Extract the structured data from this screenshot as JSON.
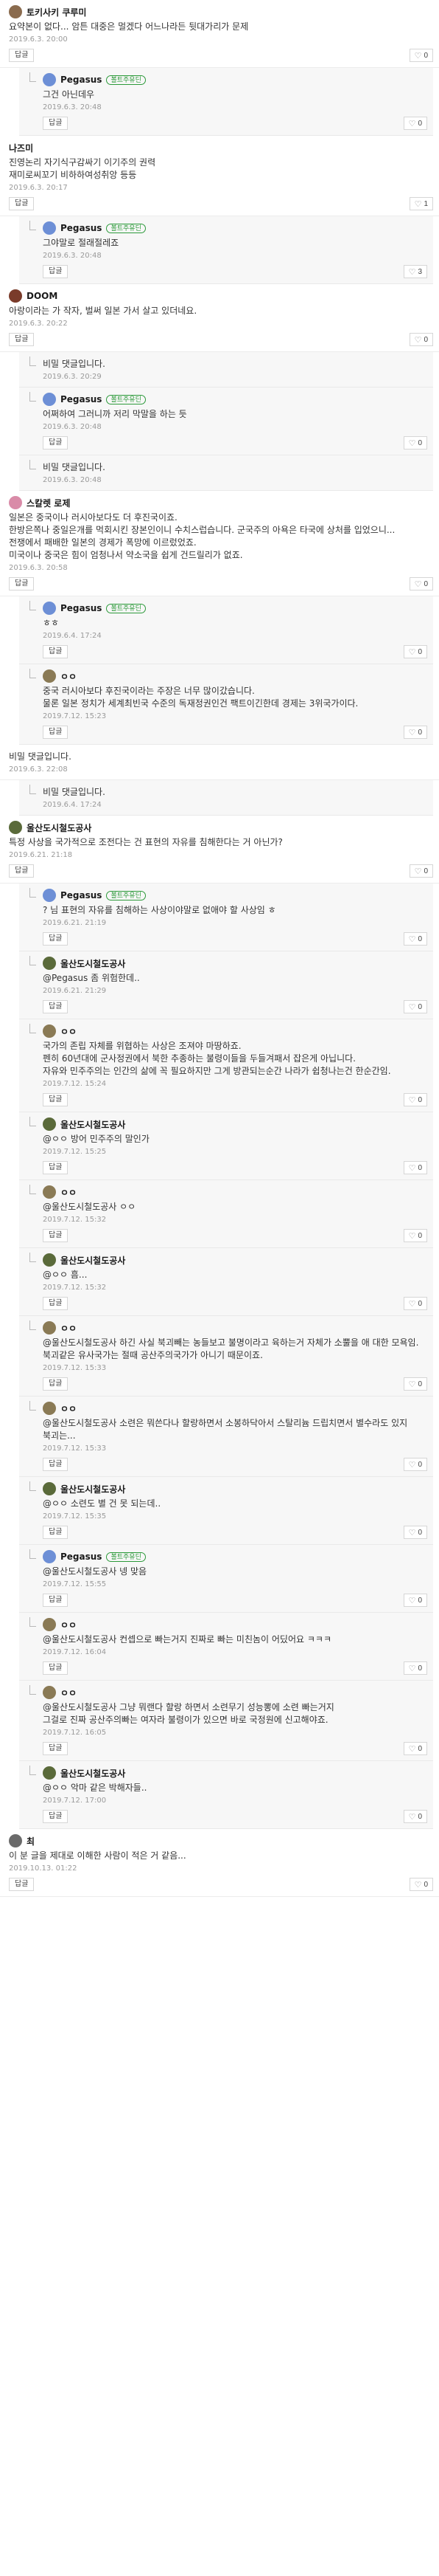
{
  "labels": {
    "reply": "답글",
    "badge": "볼트주유딘"
  },
  "comments": [
    {
      "kind": "top",
      "avatar": "#8a6b4e",
      "nick": "토키사키 쿠루미",
      "body": "요약본이 없다... 암튼 대중은 멀겠다 어느나라든 뒷대가리가 문제",
      "time": "2019.6.3. 20:00",
      "likes": "0",
      "has_avatar": true
    },
    {
      "kind": "reply",
      "avatar": "#6d8fd6",
      "nick": "Pegasus",
      "badge": true,
      "body": "그건 아닌데우",
      "time": "2019.6.3. 20:48",
      "likes": "0"
    },
    {
      "kind": "top",
      "nick": "나즈미",
      "body": "진영논리 자기식구감싸기 이기주의 권력\n재미로씨꼬기 비하하여성취앙 등등",
      "time": "2019.6.3. 20:17",
      "likes": "1",
      "has_avatar": false
    },
    {
      "kind": "reply",
      "avatar": "#6d8fd6",
      "nick": "Pegasus",
      "badge": true,
      "body": "그야말로 절래절레죠",
      "time": "2019.6.3. 20:48",
      "likes": "3"
    },
    {
      "kind": "top",
      "avatar": "#7a3b2a",
      "nick": "DOOM",
      "body": "아랑이라는 가 작자, 벌써 일본 가서 살고 있더네요.",
      "time": "2019.6.3. 20:22",
      "likes": "0",
      "has_avatar": true
    },
    {
      "kind": "secret",
      "body": "비밀 댓글입니다.",
      "time": "2019.6.3. 20:29"
    },
    {
      "kind": "reply",
      "avatar": "#6d8fd6",
      "nick": "Pegasus",
      "badge": true,
      "body": "어쩌하여 그러니까 저리 막말을 하는 듯",
      "time": "2019.6.3. 20:48",
      "likes": "0"
    },
    {
      "kind": "secret",
      "body": "비밀 댓글입니다.",
      "time": "2019.6.3. 20:48"
    },
    {
      "kind": "top",
      "avatar": "#d98ba8",
      "nick": "스칼렛 로제",
      "body": "일본은 중국이나 러시아보다도 더 후진국이죠.\n한방은쪽나 중일은개를 먹회시킨 장본인이니 수치스럽습니다. 군국주의 아욕은 타국에 상처를 입었으니...\n전쟁에서 패배한 일본의 경제가 폭망에 이르렀었죠.\n미국이나 중국은 힘이 엄청나서 약소국을 쉽게 건드릴리가 없죠.",
      "time": "2019.6.3. 20:58",
      "likes": "0",
      "has_avatar": true
    },
    {
      "kind": "reply",
      "avatar": "#6d8fd6",
      "nick": "Pegasus",
      "badge": true,
      "body": "ㅎㅎ",
      "time": "2019.6.4. 17:24",
      "likes": "0"
    },
    {
      "kind": "reply",
      "avatar": "#8a7a55",
      "nick": "ㅇㅇ",
      "body": "중국 러시아보다 후진국이라는 주장은 너무 많이갔습니다.\n물론 일본 정치가 세계최빈국 수준의 독재정권인건 팩트이긴한데 경제는 3위국가이다.",
      "time": "2019.7.12. 15:23",
      "likes": "0"
    },
    {
      "kind": "topsecret",
      "body": "비밀 댓글입니다.",
      "time": "2019.6.3. 22:08"
    },
    {
      "kind": "secret",
      "body": "비밀 댓글입니다.",
      "time": "2019.6.4. 17:24"
    },
    {
      "kind": "top",
      "avatar": "#5a6a3a",
      "nick": "울산도시철도공사",
      "body": "특정 사상을 국가적으로 조전다는 건 표현의 자유를 침해한다는 거 아닌가?",
      "time": "2019.6.21. 21:18",
      "likes": "0",
      "has_avatar": true
    },
    {
      "kind": "reply",
      "avatar": "#6d8fd6",
      "nick": "Pegasus",
      "badge": true,
      "body": "? 님 표현의 자유를 침해하는 사상이야말로 없애야 할 사상임 ㅎ",
      "time": "2019.6.21. 21:19",
      "likes": "0"
    },
    {
      "kind": "reply",
      "avatar": "#5a6a3a",
      "nick": "울산도시철도공사",
      "body": "@Pegasus  좀 위험한데..",
      "time": "2019.6.21. 21:29",
      "likes": "0"
    },
    {
      "kind": "reply",
      "avatar": "#8a7a55",
      "nick": "ㅇㅇ",
      "body": "국가의 존립 자체를 위협하는 사상은 조져야 마땅하죠.\n펜히 60년대에 군사정권에서 북한 추종하는 불령이들을 두들겨패서 잡은게 아닙니다.\n자유와 민주주의는 인간의 삶에 꼭 필요하지만 그게 방관되는순간 나라가 쉽청나는건 한순간임.",
      "time": "2019.7.12. 15:24",
      "likes": "0"
    },
    {
      "kind": "reply",
      "avatar": "#5a6a3a",
      "nick": "울산도시철도공사",
      "body": "@ㅇㅇ  방어 민주주의 말인가",
      "time": "2019.7.12. 15:25",
      "likes": "0"
    },
    {
      "kind": "reply",
      "avatar": "#8a7a55",
      "nick": "ㅇㅇ",
      "body": "@울산도시철도공사  ㅇㅇ",
      "time": "2019.7.12. 15:32",
      "likes": "0"
    },
    {
      "kind": "reply",
      "avatar": "#5a6a3a",
      "nick": "울산도시철도공사",
      "body": "@ㅇㅇ  흠...",
      "time": "2019.7.12. 15:32",
      "likes": "0"
    },
    {
      "kind": "reply",
      "avatar": "#8a7a55",
      "nick": "ㅇㅇ",
      "body": "@울산도시철도공사  하긴 사실 북괴빼는 농들보고 불명이라고 육하는거 자체가 소뿔을 애 대한 모욕임.\n북괴같은 유사국가는 절때 공산주의국가가 아니기 때문이죠.",
      "time": "2019.7.12. 15:33",
      "likes": "0"
    },
    {
      "kind": "reply",
      "avatar": "#8a7a55",
      "nick": "ㅇㅇ",
      "body": "@울산도시철도공사  소련은 뭐쓴다나 할랑하면서 소봉하닥아서 스탈리늄 드립치면서 별수라도 있지 북괴는...",
      "time": "2019.7.12. 15:33",
      "likes": "0"
    },
    {
      "kind": "reply",
      "avatar": "#5a6a3a",
      "nick": "울산도시철도공사",
      "body": "@ㅇㅇ  소련도 별 건 못 되는데..",
      "time": "2019.7.12. 15:35",
      "likes": "0"
    },
    {
      "kind": "reply",
      "avatar": "#6d8fd6",
      "nick": "Pegasus",
      "badge": true,
      "body": "@울산도시철도공사  넹 맞음",
      "time": "2019.7.12. 15:55",
      "likes": "0"
    },
    {
      "kind": "reply",
      "avatar": "#8a7a55",
      "nick": "ㅇㅇ",
      "body": "@울산도시철도공사  컨셉으로 빠는거지 진짜로 빠는 미친놈이 어딨어요 ㅋㅋㅋ",
      "time": "2019.7.12. 16:04",
      "likes": "0"
    },
    {
      "kind": "reply",
      "avatar": "#8a7a55",
      "nick": "ㅇㅇ",
      "body": "@울산도시철도공사  그냥 뭐랜다 할랑 하면서 소련무기 성능뽕에 소련 빠는거지\n그걸로 진짜 공산주의빠는 여자라 불령이가 있으면 바로 국정원에 신고해야죠.",
      "time": "2019.7.12. 16:05",
      "likes": "0"
    },
    {
      "kind": "reply",
      "avatar": "#5a6a3a",
      "nick": "울산도시철도공사",
      "body": "@ㅇㅇ  악마 같은 박해자들..",
      "time": "2019.7.12. 17:00",
      "likes": "0"
    },
    {
      "kind": "top",
      "avatar": "#6a6a6a",
      "nick": "최",
      "body": "이 분 글을 제대로 이해한 사람이 적은 거 같음...",
      "time": "2019.10.13. 01:22",
      "likes": "0",
      "has_avatar": true
    }
  ]
}
